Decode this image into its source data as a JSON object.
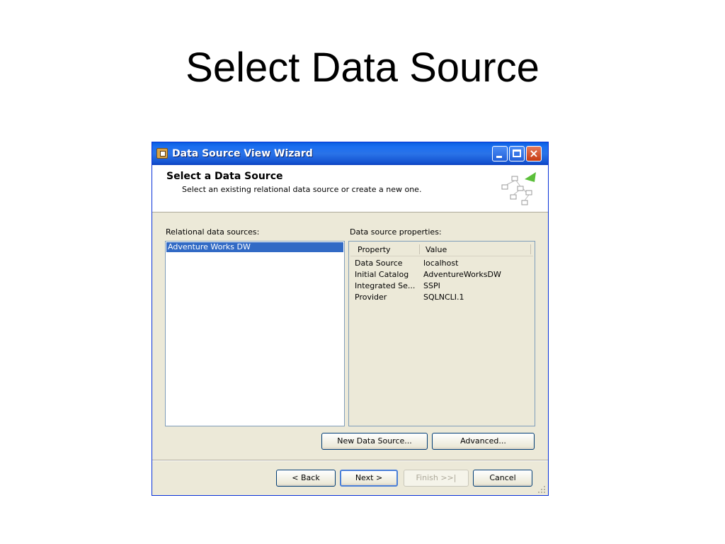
{
  "slide": {
    "title": "Select Data Source"
  },
  "window": {
    "title": "Data Source View Wizard",
    "controls": {
      "minimize": "_",
      "maximize": "□",
      "close": "×"
    }
  },
  "header": {
    "title": "Select a Data Source",
    "subtitle": "Select an existing relational data source or create a new one."
  },
  "left": {
    "label": "Relational data sources:",
    "items": [
      "Adventure Works DW"
    ],
    "selected_index": 0
  },
  "right": {
    "label": "Data source properties:",
    "columns": [
      "Property",
      "Value"
    ],
    "rows": [
      {
        "property": "Data Source",
        "value": "localhost"
      },
      {
        "property": "Initial Catalog",
        "value": "AdventureWorksDW"
      },
      {
        "property": "Integrated Se...",
        "value": "SSPI"
      },
      {
        "property": "Provider",
        "value": "SQLNCLI.1"
      }
    ]
  },
  "buttons": {
    "new_data_source": "New Data Source...",
    "advanced": "Advanced...",
    "back": "< Back",
    "next": "Next >",
    "finish": "Finish >>|",
    "cancel": "Cancel"
  },
  "icons": {
    "app": "wizard-app-icon",
    "header": "data-source-view-icon",
    "grip": "resize-grip-icon"
  },
  "colors": {
    "titlebar": "#0a5fe0",
    "selection": "#316ac5",
    "dialog_bg": "#ece9d8",
    "close_button": "#c63b12"
  }
}
